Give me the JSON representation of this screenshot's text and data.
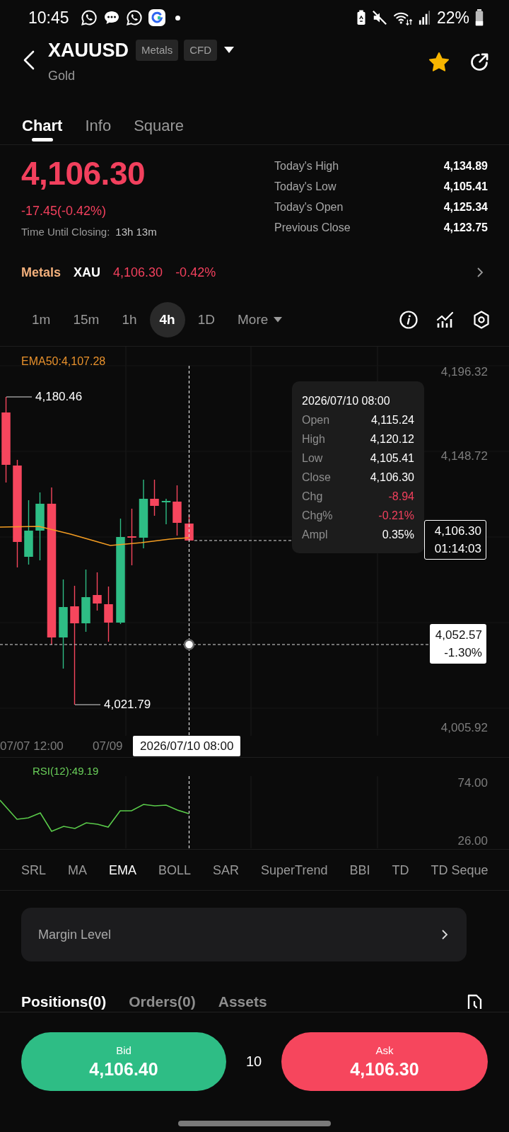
{
  "status_bar": {
    "time": "10:45",
    "battery": "22%"
  },
  "header": {
    "symbol": "XAUUSD",
    "tags": [
      "Metals",
      "CFD"
    ],
    "name": "Gold",
    "favorite": true
  },
  "tabs": [
    {
      "label": "Chart",
      "selected": true
    },
    {
      "label": "Info",
      "selected": false
    },
    {
      "label": "Square",
      "selected": false
    }
  ],
  "quote": {
    "price": "4,106.30",
    "change": "-17.45(-0.42%)",
    "closing_label": "Time Until Closing:",
    "closing_time": "13h 13m",
    "stats": [
      {
        "label": "Today's High",
        "value": "4,134.89"
      },
      {
        "label": "Today's Low",
        "value": "4,105.41"
      },
      {
        "label": "Today's Open",
        "value": "4,125.34"
      },
      {
        "label": "Previous Close",
        "value": "4,123.75"
      }
    ]
  },
  "related": {
    "category": "Metals",
    "symbol": "XAU",
    "price": "4,106.30",
    "change": "-0.42%"
  },
  "intervals": [
    {
      "label": "1m",
      "selected": false,
      "kind": "interval"
    },
    {
      "label": "15m",
      "selected": false,
      "kind": "interval"
    },
    {
      "label": "1h",
      "selected": false,
      "kind": "interval"
    },
    {
      "label": "4h",
      "selected": true,
      "kind": "interval"
    },
    {
      "label": "1D",
      "selected": false,
      "kind": "interval"
    },
    {
      "label": "More",
      "selected": false,
      "kind": "menu"
    }
  ],
  "chart": {
    "ema_label": "EMA50:4,107.28",
    "y_labels": [
      "4,196.32",
      "4,148.72",
      "4,005.92"
    ],
    "high_label": "4,180.46",
    "low_label": "4,021.79",
    "tooltip": {
      "date": "2026/07/10 08:00",
      "rows": [
        {
          "label": "Open",
          "value": "4,115.24",
          "kind": "plain"
        },
        {
          "label": "High",
          "value": "4,120.12",
          "kind": "plain"
        },
        {
          "label": "Low",
          "value": "4,105.41",
          "kind": "plain"
        },
        {
          "label": "Close",
          "value": "4,106.30",
          "kind": "plain"
        },
        {
          "label": "Chg",
          "value": "-8.94",
          "kind": "down"
        },
        {
          "label": "Chg%",
          "value": "-0.21%",
          "kind": "down"
        },
        {
          "label": "Ampl",
          "value": "0.35%",
          "kind": "plain"
        }
      ]
    },
    "last_price": "4,106.30",
    "countdown": "01:14:03",
    "crosshair_price": "4,052.57",
    "crosshair_change": "-1.30%",
    "x_labels": [
      "07/07 12:00",
      "07/09"
    ],
    "crosshair_time": "2026/07/10 08:00"
  },
  "rsi": {
    "label": "RSI(12):49.19",
    "y_labels": [
      "74.00",
      "26.00"
    ]
  },
  "indicators": [
    {
      "label": "SRL",
      "selected": false
    },
    {
      "label": "MA",
      "selected": false
    },
    {
      "label": "EMA",
      "selected": true
    },
    {
      "label": "BOLL",
      "selected": false
    },
    {
      "label": "SAR",
      "selected": false
    },
    {
      "label": "SuperTrend",
      "selected": false
    },
    {
      "label": "BBI",
      "selected": false
    },
    {
      "label": "TD",
      "selected": false
    },
    {
      "label": "TD Seque",
      "selected": false
    }
  ],
  "margin_card": {
    "label": "Margin Level"
  },
  "bottom_tabs": [
    {
      "label": "Positions(0)",
      "selected": true
    },
    {
      "label": "Orders(0)",
      "selected": false
    },
    {
      "label": "Assets",
      "selected": false
    }
  ],
  "trade": {
    "bid_label": "Bid",
    "bid": "4,106.40",
    "spread": "10",
    "ask_label": "Ask",
    "ask": "4,106.30"
  }
}
